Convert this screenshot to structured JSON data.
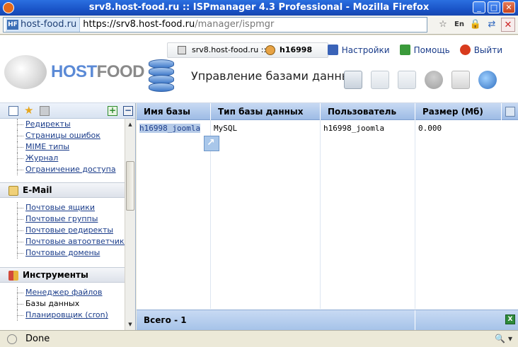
{
  "window": {
    "title": "srv8.host-food.ru :: ISPmanager 4.3 Professional - Mozilla Firefox",
    "site_identity": "host-food.ru",
    "url_scheme": "https://",
    "url_host": "srv8.host-food.ru",
    "url_path": "/manager/ispmgr",
    "ime": "En"
  },
  "header": {
    "server": "srv8.host-food.ru ::",
    "user": "h16998",
    "logo": {
      "host": "HOST",
      "food": "FOOD"
    },
    "page_title": "Управление базами данных",
    "links": {
      "settings": "Настройки",
      "help": "Помощь",
      "exit": "Выйти"
    }
  },
  "sidebar": {
    "items_top": [
      "Редиректы",
      "Страницы ошибок",
      "MIME типы",
      "Журнал",
      "Ограничение доступа"
    ],
    "email_group": "E-Mail",
    "email_items": [
      "Почтовые ящики",
      "Почтовые группы",
      "Почтовые редиректы",
      "Почтовые автоответчики",
      "Почтовые домены"
    ],
    "tools_group": "Инструменты",
    "tools_items": [
      "Менеджер файлов",
      "Базы данных",
      "Планировщик (cron)"
    ]
  },
  "table": {
    "columns": [
      "Имя базы",
      "Тип базы данных",
      "Пользователь",
      "Размер (Мб)"
    ],
    "rows": [
      [
        "h16998_joomla",
        "MySQL",
        "h16998_joomla",
        "0.000"
      ]
    ],
    "footer": "Всего - 1"
  },
  "status": {
    "text": "Done"
  },
  "colors": {
    "accent": "#2b6fe0",
    "table_header": "#b3cbec",
    "link": "#1a3c8a"
  }
}
